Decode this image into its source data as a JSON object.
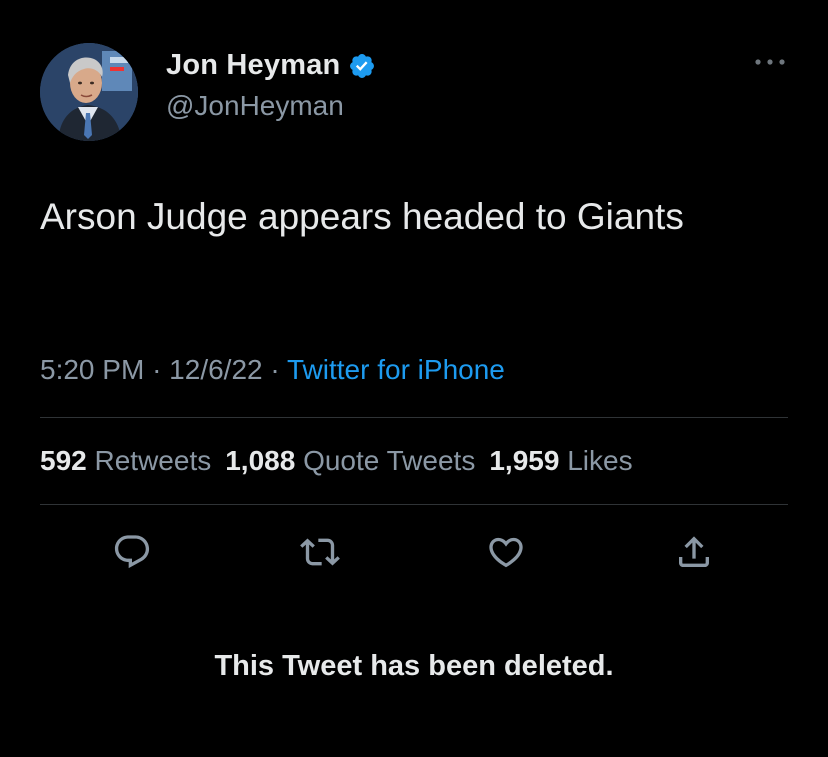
{
  "author": {
    "display_name": "Jon Heyman",
    "handle": "@JonHeyman",
    "verified": true,
    "avatar_icon": "profile-photo"
  },
  "tweet": {
    "text": "Arson Judge appears headed to Giants",
    "time": "5:20 PM",
    "date": "12/6/22",
    "separator": "·",
    "source": "Twitter for iPhone"
  },
  "stats": {
    "retweets_count": "592",
    "retweets_label": "Retweets",
    "quotes_count": "1,088",
    "quotes_label": "Quote Tweets",
    "likes_count": "1,959",
    "likes_label": "Likes"
  },
  "actions": {
    "reply_icon": "reply-icon",
    "retweet_icon": "retweet-icon",
    "like_icon": "heart-icon",
    "share_icon": "share-icon"
  },
  "status": {
    "deleted_message": "This Tweet has been deleted."
  },
  "colors": {
    "background": "#000000",
    "primary_text": "#e7e9ea",
    "secondary_text": "#8b98a5",
    "link": "#1d9bf0",
    "divider": "#2f3336",
    "verified_badge": "#1d9bf0"
  }
}
